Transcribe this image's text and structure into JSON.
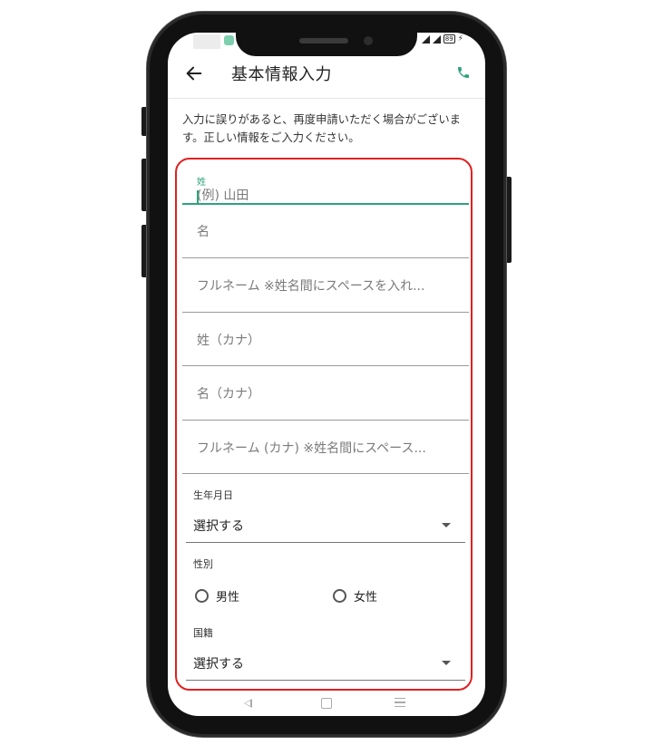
{
  "header": {
    "title": "基本情報入力"
  },
  "status": {
    "battery": "89"
  },
  "notice": "入力に誤りがあると、再度申請いただく場合がございます。正しい情報をご入力ください。",
  "form": {
    "last_name": {
      "label": "姓",
      "placeholder": "(例) 山田"
    },
    "first_name": {
      "placeholder": "名"
    },
    "full_name": {
      "placeholder": "フルネーム ※姓名間にスペースを入れ..."
    },
    "last_name_kana": {
      "placeholder": "姓（カナ）"
    },
    "first_name_kana": {
      "placeholder": "名（カナ）"
    },
    "full_name_kana": {
      "placeholder": "フルネーム (カナ) ※姓名間にスペース..."
    },
    "birthdate": {
      "label": "生年月日",
      "value": "選択する"
    },
    "gender": {
      "label": "性別",
      "options": [
        "男性",
        "女性"
      ]
    },
    "nationality": {
      "label": "国籍",
      "value": "選択する"
    }
  },
  "colors": {
    "accent": "#2ea37a",
    "highlight_border": "#e02020"
  },
  "icons": [
    "back-arrow-icon",
    "phone-icon",
    "dropdown-icon",
    "nav-back-icon",
    "nav-home-icon",
    "nav-menu-icon"
  ]
}
